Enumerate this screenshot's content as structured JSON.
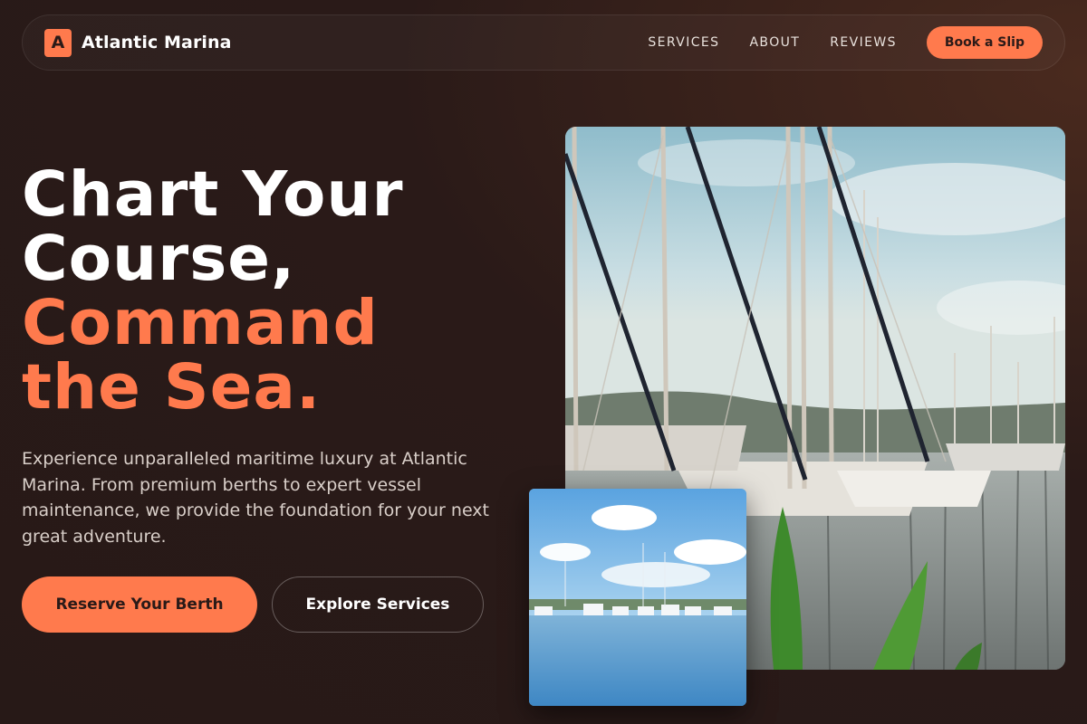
{
  "brand": {
    "mark": "A",
    "name": "Atlantic Marina",
    "accent_color": "#ff7a4d",
    "background_color": "#2a1a18"
  },
  "nav": {
    "links": [
      "SERVICES",
      "ABOUT",
      "REVIEWS"
    ],
    "cta_label": "Book a Slip"
  },
  "hero": {
    "headline_line1": "Chart Your",
    "headline_line2": "Course,",
    "headline_accent_line1": "Command",
    "headline_accent_line2": "the Sea.",
    "lead": "Experience unparalleled maritime luxury at Atlantic Marina. From premium berths to expert vessel maintenance, we provide the foundation for your next great adventure.",
    "primary_cta": "Reserve Your Berth",
    "secondary_cta": "Explore Services"
  }
}
